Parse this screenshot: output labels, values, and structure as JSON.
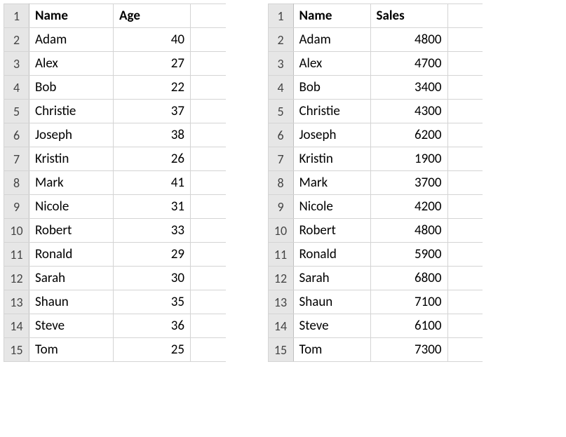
{
  "left_table": {
    "headers": {
      "col1": "Name",
      "col2": "Age"
    },
    "rows": [
      {
        "num": "1",
        "name": "",
        "value": ""
      },
      {
        "num": "2",
        "name": "Adam",
        "value": "40"
      },
      {
        "num": "3",
        "name": "Alex",
        "value": "27"
      },
      {
        "num": "4",
        "name": "Bob",
        "value": "22"
      },
      {
        "num": "5",
        "name": "Christie",
        "value": "37"
      },
      {
        "num": "6",
        "name": "Joseph",
        "value": "38"
      },
      {
        "num": "7",
        "name": "Kristin",
        "value": "26"
      },
      {
        "num": "8",
        "name": "Mark",
        "value": "41"
      },
      {
        "num": "9",
        "name": "Nicole",
        "value": "31"
      },
      {
        "num": "10",
        "name": "Robert",
        "value": "33"
      },
      {
        "num": "11",
        "name": "Ronald",
        "value": "29"
      },
      {
        "num": "12",
        "name": "Sarah",
        "value": "30"
      },
      {
        "num": "13",
        "name": "Shaun",
        "value": "35"
      },
      {
        "num": "14",
        "name": "Steve",
        "value": "36"
      },
      {
        "num": "15",
        "name": "Tom",
        "value": "25"
      }
    ]
  },
  "right_table": {
    "headers": {
      "col1": "Name",
      "col2": "Sales"
    },
    "rows": [
      {
        "num": "1",
        "name": "",
        "value": ""
      },
      {
        "num": "2",
        "name": "Adam",
        "value": "4800"
      },
      {
        "num": "3",
        "name": "Alex",
        "value": "4700"
      },
      {
        "num": "4",
        "name": "Bob",
        "value": "3400"
      },
      {
        "num": "5",
        "name": "Christie",
        "value": "4300"
      },
      {
        "num": "6",
        "name": "Joseph",
        "value": "6200"
      },
      {
        "num": "7",
        "name": "Kristin",
        "value": "1900"
      },
      {
        "num": "8",
        "name": "Mark",
        "value": "3700"
      },
      {
        "num": "9",
        "name": "Nicole",
        "value": "4200"
      },
      {
        "num": "10",
        "name": "Robert",
        "value": "4800"
      },
      {
        "num": "11",
        "name": "Ronald",
        "value": "5900"
      },
      {
        "num": "12",
        "name": "Sarah",
        "value": "6800"
      },
      {
        "num": "13",
        "name": "Shaun",
        "value": "7100"
      },
      {
        "num": "14",
        "name": "Steve",
        "value": "6100"
      },
      {
        "num": "15",
        "name": "Tom",
        "value": "7300"
      }
    ]
  }
}
